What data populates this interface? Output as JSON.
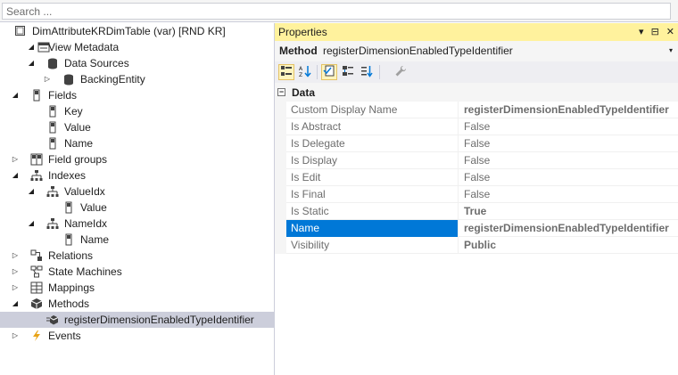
{
  "search": {
    "placeholder": "Search ..."
  },
  "tree": {
    "items": [
      {
        "label": "DimAttributeKRDimTable (var) [RND KR]",
        "icon": "table-icon",
        "expander": ""
      },
      {
        "label": "View Metadata",
        "icon": "view-metadata-icon",
        "expander": "expanded"
      },
      {
        "label": "Data Sources",
        "icon": "data-source-icon",
        "expander": "expanded"
      },
      {
        "label": "BackingEntity",
        "icon": "data-source-icon",
        "expander": "collapsed"
      },
      {
        "label": "Fields",
        "icon": "field-icon",
        "expander": "expanded"
      },
      {
        "label": "Key",
        "icon": "field-icon",
        "expander": ""
      },
      {
        "label": "Value",
        "icon": "field-icon",
        "expander": ""
      },
      {
        "label": "Name",
        "icon": "field-icon",
        "expander": ""
      },
      {
        "label": "Field groups",
        "icon": "field-group-icon",
        "expander": "collapsed"
      },
      {
        "label": "Indexes",
        "icon": "index-icon",
        "expander": "expanded"
      },
      {
        "label": "ValueIdx",
        "icon": "index-icon",
        "expander": "expanded"
      },
      {
        "label": "Value",
        "icon": "field-icon",
        "expander": ""
      },
      {
        "label": "NameIdx",
        "icon": "index-icon",
        "expander": "expanded"
      },
      {
        "label": "Name",
        "icon": "field-icon",
        "expander": ""
      },
      {
        "label": "Relations",
        "icon": "relation-icon",
        "expander": "collapsed"
      },
      {
        "label": "State Machines",
        "icon": "state-machine-icon",
        "expander": "collapsed"
      },
      {
        "label": "Mappings",
        "icon": "mapping-icon",
        "expander": "collapsed"
      },
      {
        "label": "Methods",
        "icon": "methods-icon",
        "expander": "expanded"
      },
      {
        "label": "registerDimensionEnabledTypeIdentifier",
        "icon": "method-icon",
        "expander": ""
      },
      {
        "label": "Events",
        "icon": "event-icon",
        "expander": "collapsed"
      }
    ]
  },
  "properties": {
    "title": "Properties",
    "buttons": {
      "dropdown": "▾",
      "pin": "⊟",
      "close": "✕"
    },
    "selector": {
      "kind": "Method",
      "object": "registerDimensionEnabledTypeIdentifier",
      "arrow": "▾"
    },
    "category": {
      "toggle": "−",
      "label": "Data"
    },
    "rows": [
      {
        "name": "Custom Display Name",
        "value": "registerDimensionEnabledTypeIdentifier",
        "bold": true
      },
      {
        "name": "Is Abstract",
        "value": "False",
        "bold": false
      },
      {
        "name": "Is Delegate",
        "value": "False",
        "bold": false
      },
      {
        "name": "Is Display",
        "value": "False",
        "bold": false
      },
      {
        "name": "Is Edit",
        "value": "False",
        "bold": false
      },
      {
        "name": "Is Final",
        "value": "False",
        "bold": false
      },
      {
        "name": "Is Static",
        "value": "True",
        "bold": true
      },
      {
        "name": "Name",
        "value": "registerDimensionEnabledTypeIdentifier",
        "bold": true,
        "selected": true
      },
      {
        "name": "Visibility",
        "value": "Public",
        "bold": true
      }
    ]
  },
  "colors": {
    "title_bar": "#fff29d",
    "selection": "#0078d7",
    "tree_selection": "#cccedb",
    "toolbar_active": "#fdf4bf"
  }
}
